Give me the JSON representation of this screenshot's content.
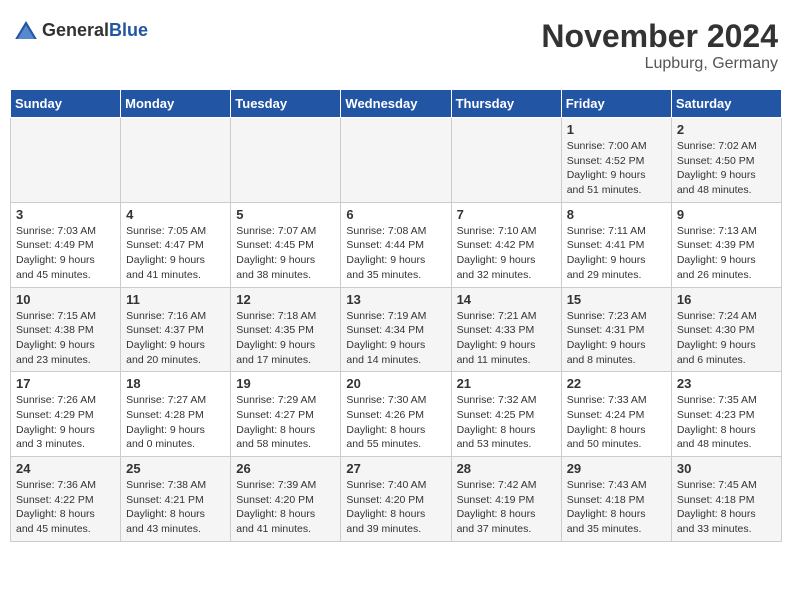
{
  "header": {
    "logo_general": "General",
    "logo_blue": "Blue",
    "month_title": "November 2024",
    "location": "Lupburg, Germany"
  },
  "days_of_week": [
    "Sunday",
    "Monday",
    "Tuesday",
    "Wednesday",
    "Thursday",
    "Friday",
    "Saturday"
  ],
  "weeks": [
    [
      {
        "day": "",
        "info": ""
      },
      {
        "day": "",
        "info": ""
      },
      {
        "day": "",
        "info": ""
      },
      {
        "day": "",
        "info": ""
      },
      {
        "day": "",
        "info": ""
      },
      {
        "day": "1",
        "info": "Sunrise: 7:00 AM\nSunset: 4:52 PM\nDaylight: 9 hours and 51 minutes."
      },
      {
        "day": "2",
        "info": "Sunrise: 7:02 AM\nSunset: 4:50 PM\nDaylight: 9 hours and 48 minutes."
      }
    ],
    [
      {
        "day": "3",
        "info": "Sunrise: 7:03 AM\nSunset: 4:49 PM\nDaylight: 9 hours and 45 minutes."
      },
      {
        "day": "4",
        "info": "Sunrise: 7:05 AM\nSunset: 4:47 PM\nDaylight: 9 hours and 41 minutes."
      },
      {
        "day": "5",
        "info": "Sunrise: 7:07 AM\nSunset: 4:45 PM\nDaylight: 9 hours and 38 minutes."
      },
      {
        "day": "6",
        "info": "Sunrise: 7:08 AM\nSunset: 4:44 PM\nDaylight: 9 hours and 35 minutes."
      },
      {
        "day": "7",
        "info": "Sunrise: 7:10 AM\nSunset: 4:42 PM\nDaylight: 9 hours and 32 minutes."
      },
      {
        "day": "8",
        "info": "Sunrise: 7:11 AM\nSunset: 4:41 PM\nDaylight: 9 hours and 29 minutes."
      },
      {
        "day": "9",
        "info": "Sunrise: 7:13 AM\nSunset: 4:39 PM\nDaylight: 9 hours and 26 minutes."
      }
    ],
    [
      {
        "day": "10",
        "info": "Sunrise: 7:15 AM\nSunset: 4:38 PM\nDaylight: 9 hours and 23 minutes."
      },
      {
        "day": "11",
        "info": "Sunrise: 7:16 AM\nSunset: 4:37 PM\nDaylight: 9 hours and 20 minutes."
      },
      {
        "day": "12",
        "info": "Sunrise: 7:18 AM\nSunset: 4:35 PM\nDaylight: 9 hours and 17 minutes."
      },
      {
        "day": "13",
        "info": "Sunrise: 7:19 AM\nSunset: 4:34 PM\nDaylight: 9 hours and 14 minutes."
      },
      {
        "day": "14",
        "info": "Sunrise: 7:21 AM\nSunset: 4:33 PM\nDaylight: 9 hours and 11 minutes."
      },
      {
        "day": "15",
        "info": "Sunrise: 7:23 AM\nSunset: 4:31 PM\nDaylight: 9 hours and 8 minutes."
      },
      {
        "day": "16",
        "info": "Sunrise: 7:24 AM\nSunset: 4:30 PM\nDaylight: 9 hours and 6 minutes."
      }
    ],
    [
      {
        "day": "17",
        "info": "Sunrise: 7:26 AM\nSunset: 4:29 PM\nDaylight: 9 hours and 3 minutes."
      },
      {
        "day": "18",
        "info": "Sunrise: 7:27 AM\nSunset: 4:28 PM\nDaylight: 9 hours and 0 minutes."
      },
      {
        "day": "19",
        "info": "Sunrise: 7:29 AM\nSunset: 4:27 PM\nDaylight: 8 hours and 58 minutes."
      },
      {
        "day": "20",
        "info": "Sunrise: 7:30 AM\nSunset: 4:26 PM\nDaylight: 8 hours and 55 minutes."
      },
      {
        "day": "21",
        "info": "Sunrise: 7:32 AM\nSunset: 4:25 PM\nDaylight: 8 hours and 53 minutes."
      },
      {
        "day": "22",
        "info": "Sunrise: 7:33 AM\nSunset: 4:24 PM\nDaylight: 8 hours and 50 minutes."
      },
      {
        "day": "23",
        "info": "Sunrise: 7:35 AM\nSunset: 4:23 PM\nDaylight: 8 hours and 48 minutes."
      }
    ],
    [
      {
        "day": "24",
        "info": "Sunrise: 7:36 AM\nSunset: 4:22 PM\nDaylight: 8 hours and 45 minutes."
      },
      {
        "day": "25",
        "info": "Sunrise: 7:38 AM\nSunset: 4:21 PM\nDaylight: 8 hours and 43 minutes."
      },
      {
        "day": "26",
        "info": "Sunrise: 7:39 AM\nSunset: 4:20 PM\nDaylight: 8 hours and 41 minutes."
      },
      {
        "day": "27",
        "info": "Sunrise: 7:40 AM\nSunset: 4:20 PM\nDaylight: 8 hours and 39 minutes."
      },
      {
        "day": "28",
        "info": "Sunrise: 7:42 AM\nSunset: 4:19 PM\nDaylight: 8 hours and 37 minutes."
      },
      {
        "day": "29",
        "info": "Sunrise: 7:43 AM\nSunset: 4:18 PM\nDaylight: 8 hours and 35 minutes."
      },
      {
        "day": "30",
        "info": "Sunrise: 7:45 AM\nSunset: 4:18 PM\nDaylight: 8 hours and 33 minutes."
      }
    ]
  ]
}
